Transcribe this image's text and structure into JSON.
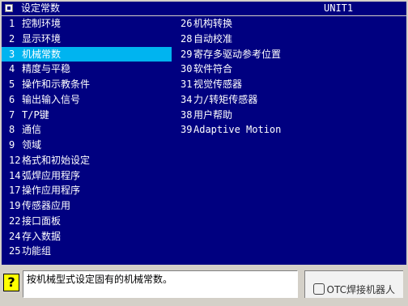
{
  "window": {
    "title": "设定常数",
    "unit": "UNIT1",
    "title_icon": "menu-icon"
  },
  "colors": {
    "title_bg": "#000080",
    "list_bg": "#000080",
    "selected_bg": "#00b4f0",
    "text": "#ffffff",
    "help_icon_bg": "#ffff00"
  },
  "menu": {
    "left": [
      {
        "num": "1",
        "label": "控制环境"
      },
      {
        "num": "2",
        "label": "显示环境"
      },
      {
        "num": "3",
        "label": "机械常数",
        "selected": true
      },
      {
        "num": "4",
        "label": "精度与平稳"
      },
      {
        "num": "5",
        "label": "操作和示教条件"
      },
      {
        "num": "6",
        "label": "输出输入信号"
      },
      {
        "num": "7",
        "label": "T/P键"
      },
      {
        "num": "8",
        "label": "通信"
      },
      {
        "num": "9",
        "label": "领域"
      },
      {
        "num": "12",
        "label": "格式和初始设定"
      },
      {
        "num": "14",
        "label": "弧焊应用程序"
      },
      {
        "num": "17",
        "label": "操作应用程序"
      },
      {
        "num": "19",
        "label": "传感器应用"
      },
      {
        "num": "22",
        "label": "接口面板"
      },
      {
        "num": "24",
        "label": "存入数据"
      },
      {
        "num": "25",
        "label": "功能组"
      }
    ],
    "right": [
      {
        "num": "26",
        "label": "机构转换"
      },
      {
        "num": "28",
        "label": "自动校准"
      },
      {
        "num": "29",
        "label": "寄存多驱动参考位置"
      },
      {
        "num": "30",
        "label": "软件符合"
      },
      {
        "num": "31",
        "label": "视觉传感器"
      },
      {
        "num": "34",
        "label": "力/转矩传感器"
      },
      {
        "num": "38",
        "label": "用户帮助"
      },
      {
        "num": "39",
        "label": "Adaptive Motion"
      }
    ]
  },
  "status": {
    "help_icon": "?",
    "message": "按机械型式设定固有的机械常数。",
    "watermark": "OTC焊接机器人"
  }
}
